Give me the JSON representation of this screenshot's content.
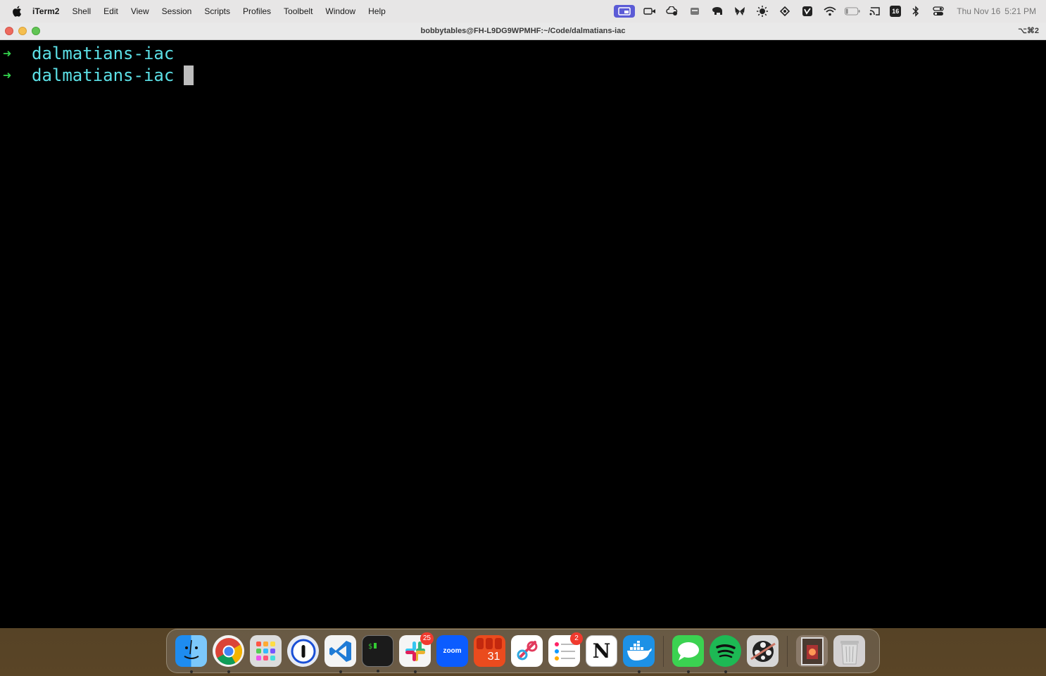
{
  "menubar": {
    "app_name": "iTerm2",
    "items": [
      "Shell",
      "Edit",
      "View",
      "Session",
      "Scripts",
      "Profiles",
      "Toolbelt",
      "Window",
      "Help"
    ],
    "status_badge": "16",
    "clock": {
      "date": "Thu Nov 16",
      "time": "5:21 PM"
    }
  },
  "window": {
    "title": "bobbytables@FH-L9DG9WPMHF:~/Code/dalmatians-iac",
    "shortcut": "⌥⌘2"
  },
  "terminal": {
    "lines": [
      {
        "arrow": "➜",
        "dir": "dalmatians-iac"
      },
      {
        "arrow": "➜",
        "dir": "dalmatians-iac"
      }
    ]
  },
  "dock": {
    "slack_badge": "25",
    "calendar_day": "31",
    "reminders_badge": "2",
    "zoom_label": "zoom",
    "notion_label": "N"
  },
  "colors": {
    "prompt_arrow": "#33d34c",
    "prompt_dir": "#5ce0e6",
    "terminal_bg": "#000000",
    "menubar_bg": "#e7e6e6"
  }
}
